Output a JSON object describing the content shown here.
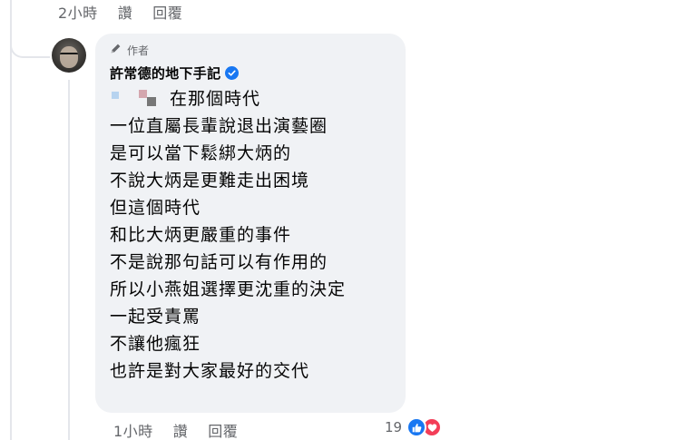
{
  "parent_meta": {
    "time": "2小時",
    "like_label": "讚",
    "reply_label": "回覆"
  },
  "comment": {
    "badge_label": "作者",
    "author": "許常德的地下手記",
    "first_line_text": "在那個時代",
    "lines": [
      "一位直屬長輩說退出演藝圈",
      "是可以當下鬆綁大炳的",
      "不說大炳是更難走出困境",
      "但這個時代",
      "和比大炳更嚴重的事件",
      "不是說那句話可以有作用的",
      "所以小燕姐選擇更沈重的決定",
      "一起受責罵",
      "不讓他瘋狂",
      "也許是對大家最好的交代"
    ]
  },
  "comment_meta": {
    "time": "1小時",
    "like_label": "讚",
    "reply_label": "回覆",
    "reaction_count": "19"
  },
  "icons": {
    "badge": "pencil-icon",
    "verified": "verified-check-icon",
    "like": "thumbs-up-icon",
    "love": "heart-icon"
  },
  "colors": {
    "bubble": "#f0f2f5",
    "meta_text": "#65676b",
    "verified": "#1877f2",
    "like": "#1877f2",
    "love": "#f33e58"
  }
}
